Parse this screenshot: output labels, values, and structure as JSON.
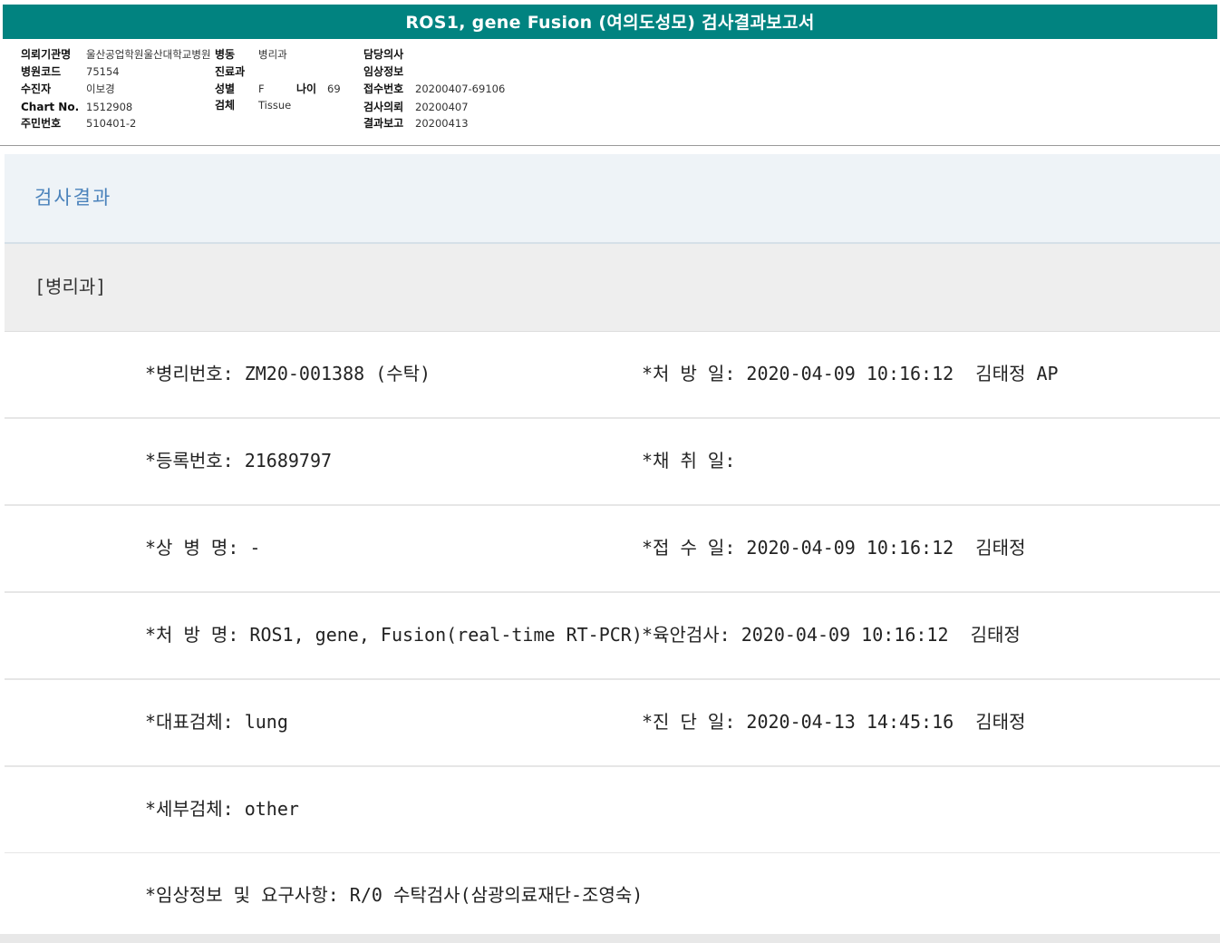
{
  "title": "ROS1, gene Fusion (여의도성모) 검사결과보고서",
  "info": {
    "institution_label": "의뢰기관명",
    "institution_value": "울산공업학원울산대학교병원",
    "ward_label": "병동",
    "ward_value": "병리과",
    "doctor_label": "담당의사",
    "doctor_value": "",
    "hospital_code_label": "병원코드",
    "hospital_code_value": "75154",
    "dept_label": "진료과",
    "dept_value": "",
    "clinical_label": "임상정보",
    "clinical_value": "",
    "patient_label": "수진자",
    "patient_value": "이보경",
    "sex_label": "성별",
    "sex_value": "F",
    "age_label": "나이",
    "age_value": "69",
    "receipt_no_label": "접수번호",
    "receipt_no_value": "20200407-69106",
    "chart_label": "Chart No.",
    "chart_value": "1512908",
    "specimen_label": "검체",
    "specimen_value": "Tissue",
    "request_date_label": "검사의뢰",
    "request_date_value": "20200407",
    "rrn_label": "주민번호",
    "rrn_value": "510401-2",
    "report_date_label": "결과보고",
    "report_date_value": "20200413"
  },
  "section_title": "검사결과",
  "dept_heading": "[병리과]",
  "rows": [
    {
      "left": "*병리번호: ZM20-001388 (수탁)",
      "right": "*처 방 일: 2020-04-09 10:16:12  김태정 AP"
    },
    {
      "left": "*등록번호: 21689797",
      "right": "*채 취 일:"
    },
    {
      "left": "*상 병 명: -",
      "right": "*접 수 일: 2020-04-09 10:16:12  김태정"
    },
    {
      "left": "*처 방 명: ROS1, gene, Fusion(real-time RT-PCR)",
      "right": "*육안검사: 2020-04-09 10:16:12  김태정"
    },
    {
      "left": "*대표검체: lung",
      "right": "*진 단 일: 2020-04-13 14:45:16  김태정"
    },
    {
      "left": "*세부검체: other",
      "right": ""
    },
    {
      "left": "*임상정보 및 요구사항: R/0 수탁검사(삼광의료재단-조영숙)",
      "right": ""
    }
  ],
  "colors": {
    "title_bar": "#018380",
    "section_title": "#4a82bb",
    "section_bg": "#eef3f7",
    "dept_bg": "#eeeeee"
  }
}
